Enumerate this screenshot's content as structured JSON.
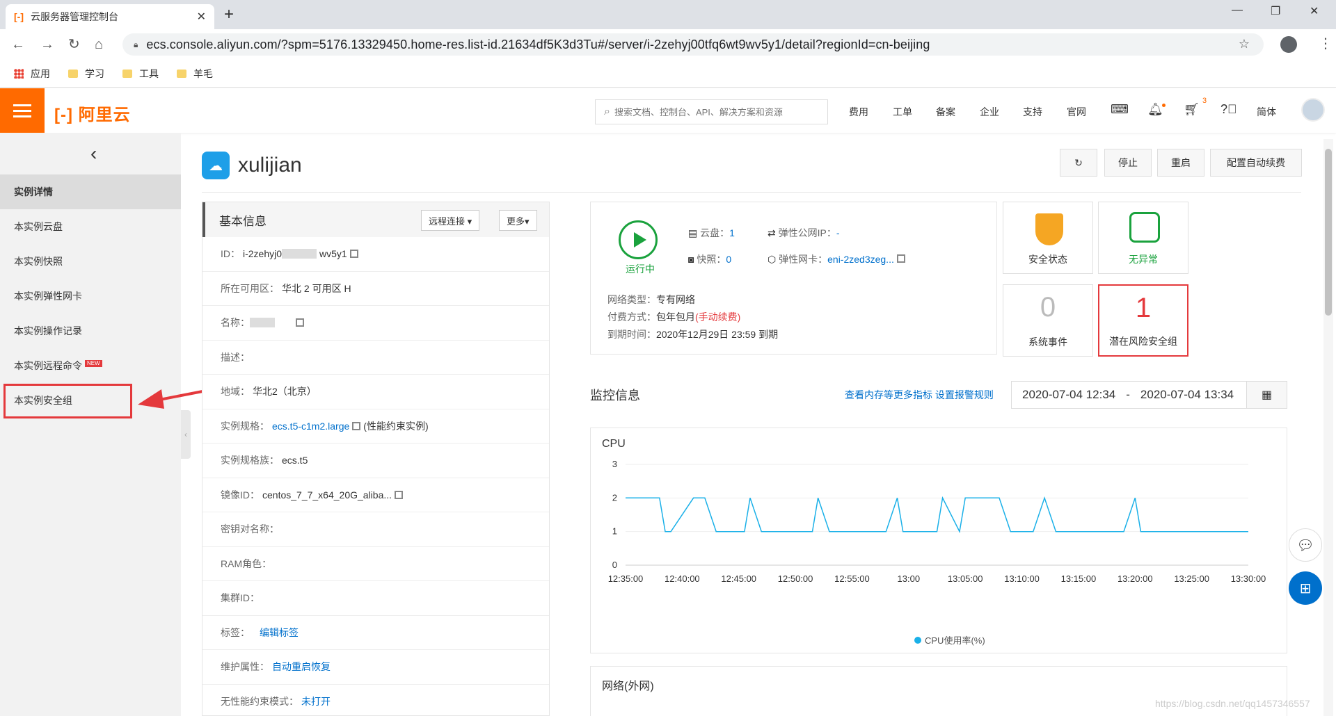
{
  "browser": {
    "tab_title": "云服务器管理控制台",
    "tab_logo": "[-]",
    "url": "ecs.console.aliyun.com/?spm=5176.13329450.home-res.list-id.21634df5K3d3Tu#/server/i-2zehyj00tfq6wt9wv5y1/detail?regionId=cn-beijing",
    "bookmarks": [
      "应用",
      "学习",
      "工具",
      "羊毛"
    ]
  },
  "header": {
    "logo": "[-] 阿里云",
    "search_placeholder": "搜索文档、控制台、API、解决方案和资源",
    "nav": [
      "费用",
      "工单",
      "备案",
      "企业",
      "支持",
      "官网"
    ],
    "cart_count": "3",
    "lang": "简体"
  },
  "sidebar": {
    "items": [
      {
        "label": "实例详情"
      },
      {
        "label": "本实例云盘"
      },
      {
        "label": "本实例快照"
      },
      {
        "label": "本实例弹性网卡"
      },
      {
        "label": "本实例操作记录"
      },
      {
        "label": "本实例远程命令"
      },
      {
        "label": "本实例安全组"
      }
    ],
    "new_badge": "NEW"
  },
  "instance": {
    "name": "xulijian",
    "actions": [
      "停止",
      "重启",
      "配置自动续费"
    ]
  },
  "basic": {
    "title": "基本信息",
    "remote_btn": "远程连接 ▾",
    "more_btn": "更多▾",
    "rows": [
      {
        "label": "ID：",
        "value": "i-2zehyj0",
        "value2": "wv5y1"
      },
      {
        "label": "所在可用区：",
        "value": "华北 2 可用区 H"
      },
      {
        "label": "名称：",
        "value": ""
      },
      {
        "label": "描述：",
        "value": ""
      },
      {
        "label": "地域：",
        "value": "华北2（北京）"
      },
      {
        "label": "实例规格：",
        "value": "ecs.t5-c1m2.large",
        "note": "(性能约束实例)"
      },
      {
        "label": "实例规格族：",
        "value": "ecs.t5"
      },
      {
        "label": "镜像ID：",
        "value": "centos_7_7_x64_20G_aliba..."
      },
      {
        "label": "密钥对名称：",
        "value": ""
      },
      {
        "label": "RAM角色：",
        "value": ""
      },
      {
        "label": "集群ID：",
        "value": ""
      },
      {
        "label": "标签：",
        "value": "编辑标签"
      },
      {
        "label": "维护属性：",
        "value": "自动重启恢复"
      },
      {
        "label": "无性能约束模式：",
        "value": "未打开"
      }
    ]
  },
  "status": {
    "run_label": "运行中",
    "disk_label": "云盘：",
    "disk_val": "1",
    "snap_label": "快照：",
    "snap_val": "0",
    "eip_label": "弹性公网IP：",
    "eip_val": "-",
    "eni_label": "弹性网卡：",
    "eni_val": "eni-2zed3zeg...",
    "net_type_label": "网络类型：",
    "net_type_val": "专有网络",
    "pay_label": "付费方式：",
    "pay_val": "包年包月",
    "pay_note": "(手动续费)",
    "expire_label": "到期时间：",
    "expire_val": "2020年12月29日 23:59 到期"
  },
  "cards": {
    "security": "安全状态",
    "normal": "无异常",
    "events_num": "0",
    "events": "系统事件",
    "risk_num": "1",
    "risk": "潜在风险安全组"
  },
  "monitor": {
    "title": "监控信息",
    "links": "查看内存等更多指标  设置报警规则",
    "date_from": "2020-07-04 12:34",
    "date_sep": "-",
    "date_to": "2020-07-04 13:34",
    "net_title": "网络(外网)"
  },
  "chart_data": {
    "type": "line",
    "title": "CPU",
    "xlabel": "",
    "ylabel": "",
    "ylim": [
      0,
      3
    ],
    "yticks": [
      0,
      1,
      2,
      3
    ],
    "xticks": [
      "12:35:00",
      "12:40:00",
      "12:45:00",
      "12:50:00",
      "12:55:00",
      "13:00",
      "13:05:00",
      "13:10:00",
      "13:15:00",
      "13:20:00",
      "13:25:00",
      "13:30:00"
    ],
    "series": [
      {
        "name": "CPU使用率(%)",
        "color": "#1ab0e8",
        "x_minutes": [
          0,
          2,
          3,
          3.5,
          4,
          6,
          7,
          8,
          9.5,
          10.5,
          11,
          12,
          12.5,
          15.5,
          16.5,
          17,
          18,
          18.5,
          21.5,
          22.5,
          23,
          24,
          24.5,
          26,
          27,
          27.5,
          28,
          29.5,
          30,
          33,
          34,
          34.5,
          36,
          37,
          38,
          38.5,
          40.5,
          41,
          41.5,
          43,
          44,
          45,
          45.5,
          47,
          48,
          49,
          50,
          55
        ],
        "values": [
          2,
          2,
          2,
          1,
          1,
          2,
          2,
          1,
          1,
          1,
          2,
          1,
          1,
          1,
          1,
          2,
          1,
          1,
          1,
          1,
          1,
          2,
          1,
          1,
          1,
          1,
          2,
          1,
          2,
          2,
          1,
          1,
          1,
          2,
          1,
          1,
          1,
          1,
          1,
          1,
          1,
          2,
          1,
          1,
          1,
          1,
          1,
          1
        ]
      }
    ]
  },
  "watermark": "https://blog.csdn.net/qq1457346557"
}
